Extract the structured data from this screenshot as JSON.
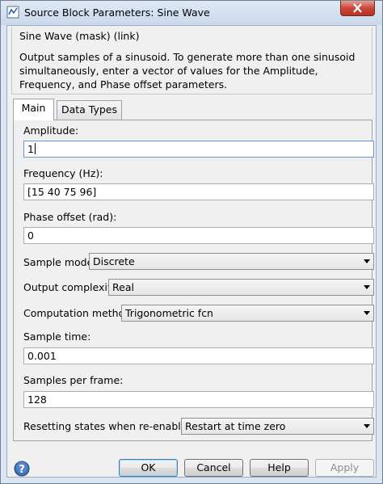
{
  "window": {
    "title": "Source Block Parameters: Sine Wave"
  },
  "mask": {
    "title": "Sine Wave (mask) (link)",
    "description": "Output samples of a sinusoid.  To generate more than one sinusoid simultaneously, enter a vector of values for the Amplitude, Frequency, and Phase offset parameters."
  },
  "tabs": [
    {
      "label": "Main",
      "active": true
    },
    {
      "label": "Data Types",
      "active": false
    }
  ],
  "params": {
    "amplitude": {
      "label": "Amplitude:",
      "value": "1"
    },
    "frequency": {
      "label": "Frequency (Hz):",
      "value": "[15 40 75 96]"
    },
    "phase": {
      "label": "Phase offset (rad):",
      "value": "0"
    },
    "sample_mode": {
      "label": "Sample mode:",
      "value": "Discrete"
    },
    "output_complexity": {
      "label": "Output complexity:",
      "value": "Real"
    },
    "computation_method": {
      "label": "Computation method:",
      "value": "Trigonometric fcn"
    },
    "sample_time": {
      "label": "Sample time:",
      "value": "0.001"
    },
    "samples_per_frame": {
      "label": "Samples per frame:",
      "value": "128"
    },
    "resetting_states": {
      "label": "Resetting states when re-enabled:",
      "value": "Restart at time zero"
    }
  },
  "buttons": {
    "ok": "OK",
    "cancel": "Cancel",
    "help": "Help",
    "apply": "Apply"
  },
  "icons": {
    "app": "simulink-block-icon",
    "close": "close-icon",
    "help": "help-question-icon"
  }
}
